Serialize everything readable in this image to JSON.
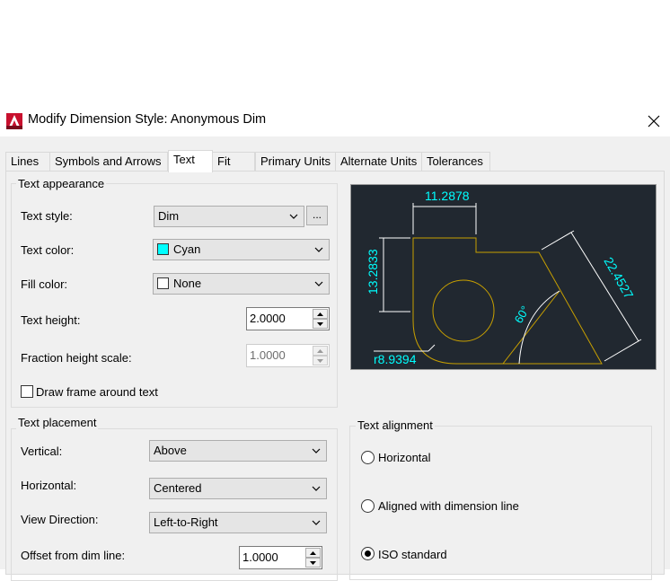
{
  "window": {
    "title": "Modify Dimension Style: Anonymous Dim"
  },
  "tabs": [
    {
      "label": "Lines",
      "active": false
    },
    {
      "label": "Symbols and Arrows",
      "active": false
    },
    {
      "label": "Text",
      "active": true
    },
    {
      "label": "Fit",
      "active": false
    },
    {
      "label": "Primary Units",
      "active": false
    },
    {
      "label": "Alternate Units",
      "active": false
    },
    {
      "label": "Tolerances",
      "active": false
    }
  ],
  "text_appearance": {
    "title": "Text appearance",
    "text_style": {
      "label": "Text style:",
      "value": "Dim",
      "browse_label": "..."
    },
    "text_color": {
      "label": "Text color:",
      "value": "Cyan",
      "swatch": "#00ffff"
    },
    "fill_color": {
      "label": "Fill color:",
      "value": "None",
      "swatch": "#ffffff"
    },
    "text_height": {
      "label": "Text height:",
      "value": "2.0000"
    },
    "fraction_height_scale": {
      "label": "Fraction height scale:",
      "value": "1.0000"
    },
    "draw_frame": {
      "label": "Draw frame around text",
      "checked": false
    }
  },
  "text_placement": {
    "title": "Text placement",
    "vertical": {
      "label": "Vertical:",
      "value": "Above"
    },
    "horizontal": {
      "label": "Horizontal:",
      "value": "Centered"
    },
    "view_direction": {
      "label": "View Direction:",
      "value": "Left-to-Right"
    },
    "offset": {
      "label": "Offset from dim line:",
      "value": "1.0000"
    }
  },
  "text_alignment": {
    "title": "Text alignment",
    "options": [
      {
        "label": "Horizontal",
        "selected": false
      },
      {
        "label": "Aligned with dimension line",
        "selected": false
      },
      {
        "label": "ISO standard",
        "selected": true
      }
    ]
  },
  "preview": {
    "dim_top": "11.2878",
    "dim_left": "13.2833",
    "dim_angled": "22.4527",
    "dim_angle": "60°",
    "dim_radius": "r8.9394",
    "colors": {
      "background": "#212830",
      "geometry": "#c8a000",
      "text": "#00ffff",
      "lines": "#ffffff"
    }
  },
  "icons": {
    "app": "autocad-app-icon",
    "close": "close-icon",
    "dropdown": "chevron-down-icon"
  }
}
